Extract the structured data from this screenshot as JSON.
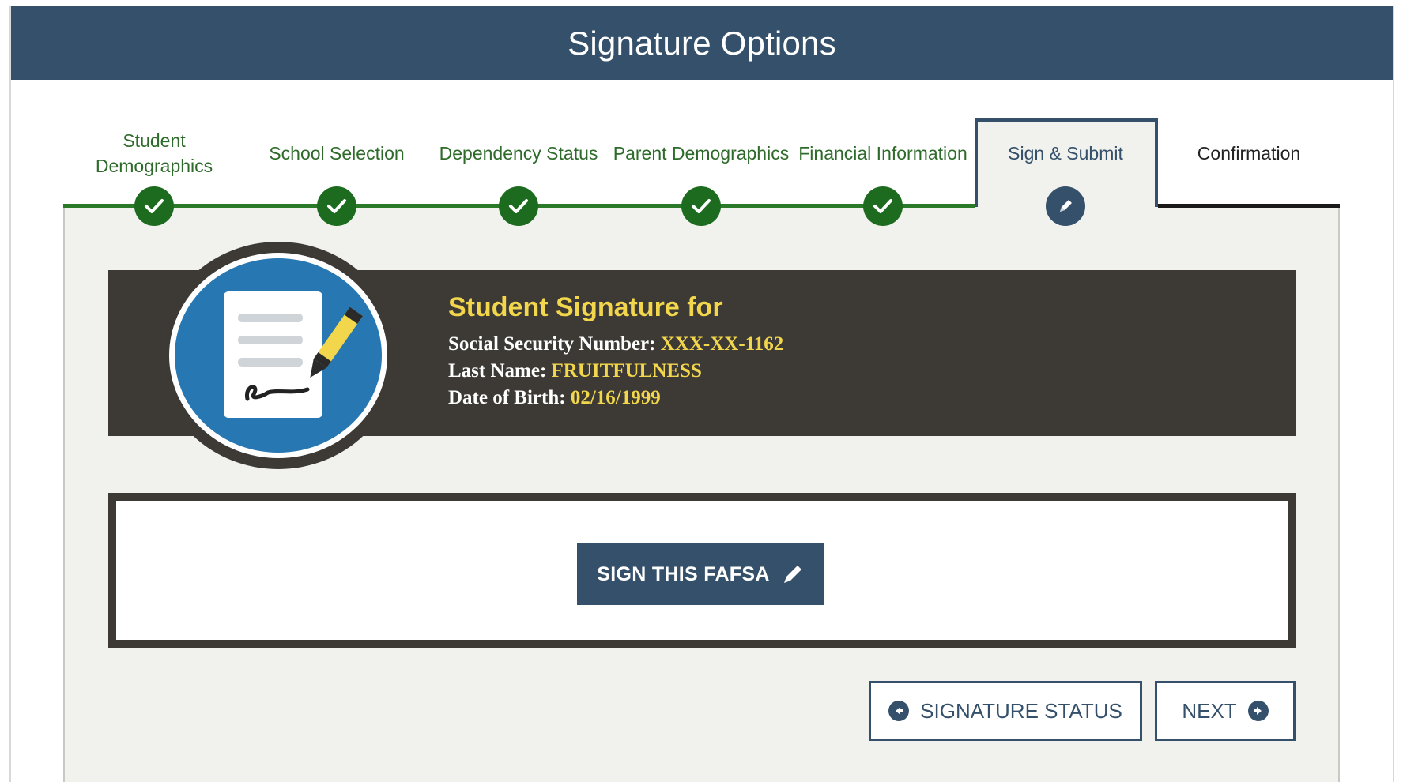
{
  "header": {
    "title": "Signature Options"
  },
  "steps": [
    {
      "label": "Student Demographics",
      "state": "complete"
    },
    {
      "label": "School Selection",
      "state": "complete"
    },
    {
      "label": "Dependency Status",
      "state": "complete"
    },
    {
      "label": "Parent Demographics",
      "state": "complete"
    },
    {
      "label": "Financial Information",
      "state": "complete"
    },
    {
      "label": "Sign & Submit",
      "state": "active"
    },
    {
      "label": "Confirmation",
      "state": "future"
    }
  ],
  "signature": {
    "title": "Student Signature for",
    "ssn_label": "Social Security Number:",
    "ssn_value": "XXX-XX-1162",
    "last_name_label": "Last Name:",
    "last_name_value": "FRUITFULNESS",
    "dob_label": "Date of Birth:",
    "dob_value": "02/16/1999"
  },
  "actions": {
    "sign_label": "SIGN THIS FAFSA",
    "signature_status_label": "SIGNATURE STATUS",
    "next_label": "NEXT"
  },
  "colors": {
    "header_bg": "#34506a",
    "complete_green": "#1d6b1f",
    "banner_bg": "#3d3a36",
    "highlight_yellow": "#f2d64b",
    "icon_blue": "#2677b2"
  }
}
